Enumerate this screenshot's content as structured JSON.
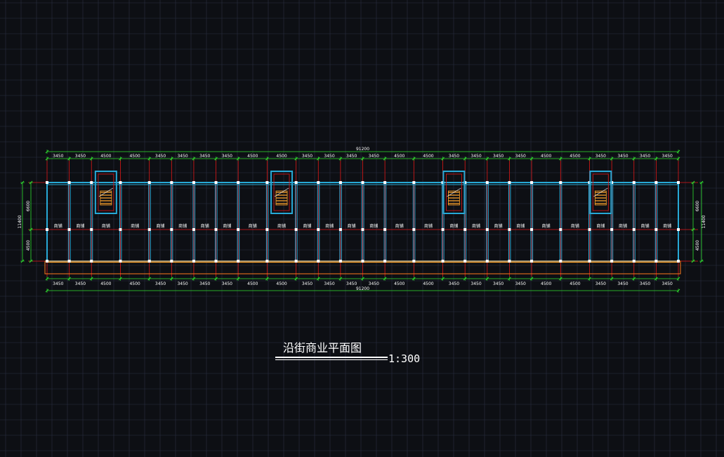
{
  "drawing": {
    "title": "沿街商业平面图",
    "scale": "1:300",
    "total_length": "91200",
    "total_depth": "11400",
    "front_depth": "6600",
    "rear_depth": "4500",
    "room_label": "商铺",
    "bays": [
      "3450",
      "3450",
      "4500",
      "4500",
      "3450",
      "3450",
      "3450",
      "3450",
      "4500",
      "4500",
      "3450",
      "3450",
      "3450",
      "3450",
      "4500",
      "4500",
      "3450",
      "3450",
      "3450",
      "3450",
      "4500",
      "4500",
      "3450",
      "3450",
      "3450",
      "3450"
    ],
    "stair_bays": [
      2,
      9,
      16,
      22
    ]
  },
  "colors": {
    "background": "#0d0f14",
    "grid": "#2b3040",
    "wall": "#27a9d6",
    "axis": "#e01818",
    "dimension": "#2fe02f",
    "stair": "#ffa32a",
    "canopy": "#ff7a1a"
  }
}
